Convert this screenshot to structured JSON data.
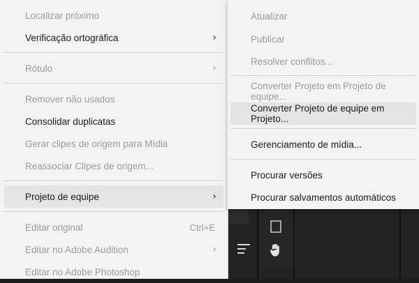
{
  "main_menu": {
    "items": [
      {
        "label": "Localizar próximo",
        "enabled": false
      },
      {
        "label": "Verificação ortográfica",
        "enabled": true,
        "submenu": true
      },
      {
        "label": "Rótulo",
        "enabled": false,
        "submenu": true
      },
      {
        "label": "Remover não usados",
        "enabled": false
      },
      {
        "label": "Consolidar duplicatas",
        "enabled": true
      },
      {
        "label": "Gerar clipes de origem para Mídia",
        "enabled": false
      },
      {
        "label": "Reassociar Clipes de origem...",
        "enabled": false
      },
      {
        "label": "Projeto de equipe",
        "enabled": true,
        "submenu": true,
        "highlighted": true
      },
      {
        "label": "Editar original",
        "enabled": false,
        "shortcut": "Ctrl+E"
      },
      {
        "label": "Editar no Adobe Audition",
        "enabled": false,
        "submenu": true
      },
      {
        "label": "Editar no Adobe Photoshop",
        "enabled": false
      }
    ],
    "arrow_glyph": "›"
  },
  "team_project_submenu": {
    "items": [
      {
        "label": "Atualizar",
        "enabled": false
      },
      {
        "label": "Publicar",
        "enabled": false
      },
      {
        "label": "Resolver conflitos...",
        "enabled": false
      },
      {
        "label": "Converter Projeto em Projeto de equipe...",
        "enabled": false
      },
      {
        "label": "Converter Projeto de equipe em Projeto...",
        "enabled": true,
        "highlighted": true
      },
      {
        "label": "Gerenciamento de mídia...",
        "enabled": true
      },
      {
        "label": "Procurar versões",
        "enabled": true
      },
      {
        "label": "Procurar salvamentos automáticos",
        "enabled": true
      }
    ]
  },
  "background": {
    "icons": [
      "hamburger-menu-icon",
      "stop-square-icon",
      "hand-tool-icon"
    ]
  },
  "colors": {
    "menu_bg": "#f3f3f3",
    "highlight_bg": "#e4e4e4",
    "disabled_text": "#9c9c9c",
    "app_bg": "#1d1d1d"
  }
}
